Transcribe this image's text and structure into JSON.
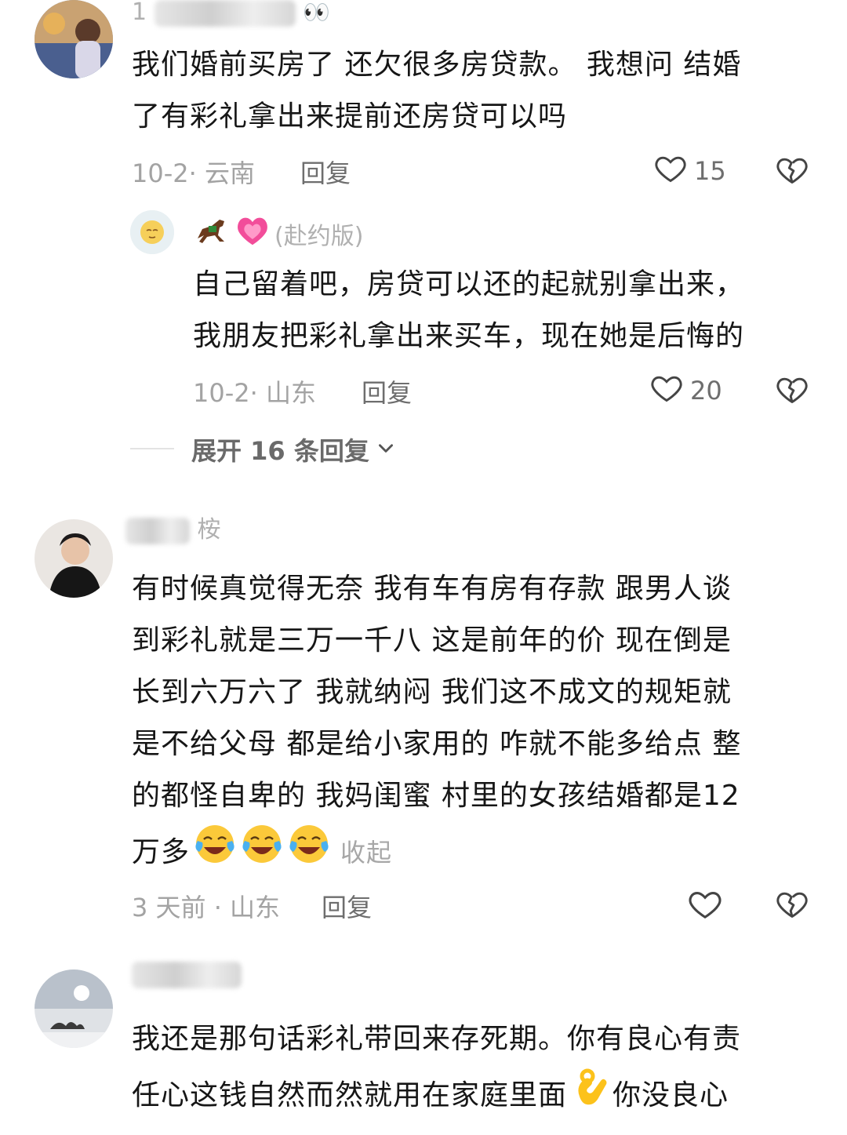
{
  "comments": [
    {
      "username_visible": "1",
      "text_lines": [
        "我们婚前买房了 还欠很多房贷款。 我想问 结婚",
        "了有彩礼拿出来提前还房贷可以吗"
      ],
      "date": "10-2· 云南",
      "reply_label": "回复",
      "likes": "15",
      "reply": {
        "badge": "(赴约版)",
        "text_lines": [
          "自己留着吧，房贷可以还的起就别拿出来，",
          "我朋友把彩礼拿出来买车，现在她是后悔的"
        ],
        "date": "10-2· 山东",
        "reply_label": "回复",
        "likes": "20"
      },
      "expand_label": "展开 16 条回复"
    },
    {
      "username_visible": "桉",
      "text_lines": [
        "有时候真觉得无奈 我有车有房有存款 跟男人谈",
        "到彩礼就是三万一千八 这是前年的价 现在倒是",
        "长到六万六了 我就纳闷 我们这不成文的规矩就",
        "是不给父母 都是给小家用的 咋就不能多给点 整",
        "的都怪自卑的 我妈闺蜜 村里的女孩结婚都是12"
      ],
      "last_line": "万多",
      "collapse_label": "收起",
      "date": "3 天前 · 山东",
      "reply_label": "回复"
    },
    {
      "username_visible": "",
      "text_lines": [
        "我还是那句话彩礼带回来存死期。你有良心有责"
      ],
      "line2_a": "任心这钱自然而然就用在家庭里面",
      "line2_b": "你没良心"
    }
  ],
  "icons": {
    "like": "heart-outline-icon",
    "dislike": "broken-heart-icon",
    "expand_chevron": "chevron-down-icon",
    "emoji_laugh_cry": "face-with-tears-of-joy-icon",
    "emoji_ok": "ok-hand-icon",
    "emoji_horse": "racing-horse-icon",
    "emoji_heart": "growing-heart-icon"
  },
  "colors": {
    "text": "#161616",
    "meta": "#a3a3a3",
    "action": "#6e6e6e"
  }
}
